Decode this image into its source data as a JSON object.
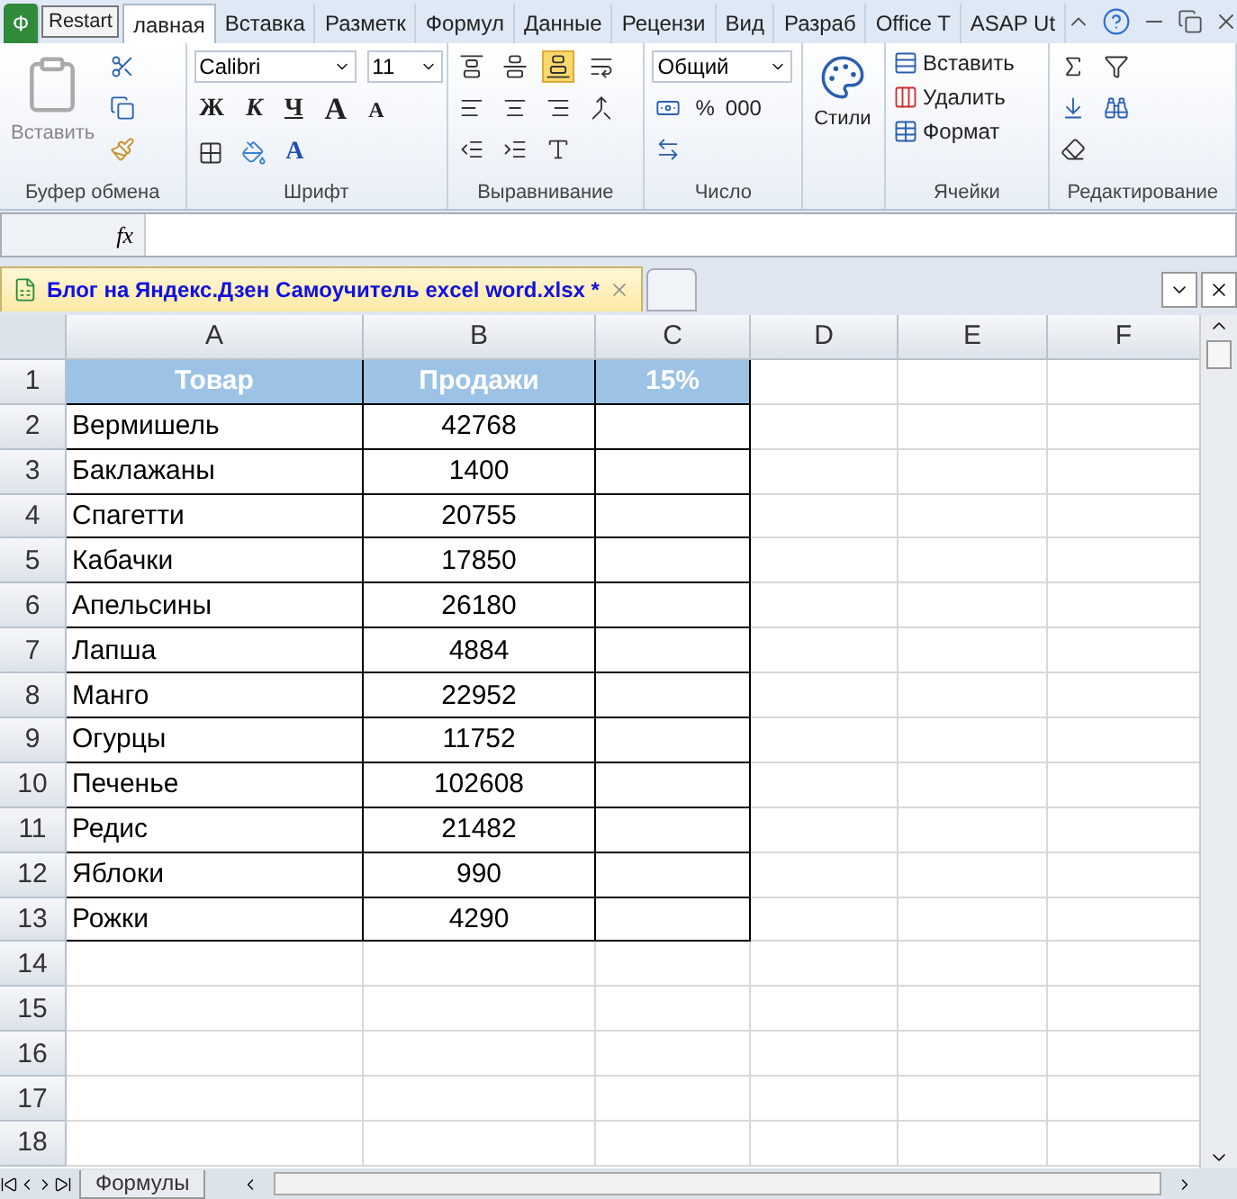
{
  "tooltip": {
    "text": "Restart"
  },
  "ribbon_tabs": [
    {
      "label": "Ф",
      "kind": "file",
      "selected": false
    },
    {
      "label": "лавная",
      "kind": "tab",
      "selected": true
    },
    {
      "label": "Вставка",
      "kind": "tab",
      "selected": false
    },
    {
      "label": "Разметк",
      "kind": "tab",
      "selected": false
    },
    {
      "label": "Формул",
      "kind": "tab",
      "selected": false
    },
    {
      "label": "Данные",
      "kind": "tab",
      "selected": false
    },
    {
      "label": "Рецензи",
      "kind": "tab",
      "selected": false
    },
    {
      "label": "Вид",
      "kind": "tab",
      "selected": false
    },
    {
      "label": "Разраб",
      "kind": "tab",
      "selected": false
    },
    {
      "label": "Office T",
      "kind": "tab",
      "selected": false
    },
    {
      "label": "ASAP Ut",
      "kind": "tab",
      "selected": false
    }
  ],
  "ribbon": {
    "clipboard": {
      "title": "Буфер обмена",
      "paste": "Вставить"
    },
    "font": {
      "title": "Шрифт",
      "font_name": "Calibri",
      "font_size": "11",
      "bold": "Ж",
      "italic": "К",
      "underline": "Ч",
      "grow": "A",
      "shrink": "A",
      "font_color_label": "A"
    },
    "alignment": {
      "title": "Выравнивание",
      "vertical": [
        {
          "selected": false
        },
        {
          "selected": false
        },
        {
          "selected": true
        }
      ]
    },
    "number": {
      "title": "Число",
      "format": "Общий",
      "percent": "%",
      "thousands": "000"
    },
    "styles": {
      "label": "Стили"
    },
    "cells": {
      "title": "Ячейки",
      "insert": "Вставить",
      "delete": "Удалить",
      "format": "Формат"
    },
    "editing": {
      "title": "Редактирование"
    }
  },
  "formula_bar": {
    "fx": "fx"
  },
  "document_tabs": [
    {
      "label": "Блог на Яндекс.Дзен Самоучитель excel word.xlsx *",
      "selected": true
    }
  ],
  "sheet": {
    "columns": [
      "A",
      "B",
      "C",
      "D",
      "E",
      "F"
    ],
    "rows": [
      {
        "number": "1",
        "cells": [
          "Товар",
          "Продажи",
          "15%"
        ],
        "header": true
      },
      {
        "number": "2",
        "cells": [
          "Вермишель",
          "42768",
          ""
        ],
        "header": false
      },
      {
        "number": "3",
        "cells": [
          "Баклажаны",
          "1400",
          ""
        ],
        "header": false
      },
      {
        "number": "4",
        "cells": [
          "Спагетти",
          "20755",
          ""
        ],
        "header": false
      },
      {
        "number": "5",
        "cells": [
          "Кабачки",
          "17850",
          ""
        ],
        "header": false
      },
      {
        "number": "6",
        "cells": [
          "Апельсины",
          "26180",
          ""
        ],
        "header": false
      },
      {
        "number": "7",
        "cells": [
          "Лапша",
          "4884",
          ""
        ],
        "header": false
      },
      {
        "number": "8",
        "cells": [
          "Манго",
          "22952",
          ""
        ],
        "header": false
      },
      {
        "number": "9",
        "cells": [
          "Огурцы",
          "11752",
          ""
        ],
        "header": false
      },
      {
        "number": "10",
        "cells": [
          "Печенье",
          "102608",
          ""
        ],
        "header": false
      },
      {
        "number": "11",
        "cells": [
          "Редис",
          "21482",
          ""
        ],
        "header": false
      },
      {
        "number": "12",
        "cells": [
          "Яблоки",
          "990",
          ""
        ],
        "header": false
      },
      {
        "number": "13",
        "cells": [
          "Рожки",
          "4290",
          ""
        ],
        "header": false
      }
    ],
    "empty_rows": [
      "14",
      "15",
      "16",
      "17",
      "18"
    ]
  },
  "sheet_tabs": [
    {
      "label": "Формулы",
      "selected": false
    }
  ]
}
